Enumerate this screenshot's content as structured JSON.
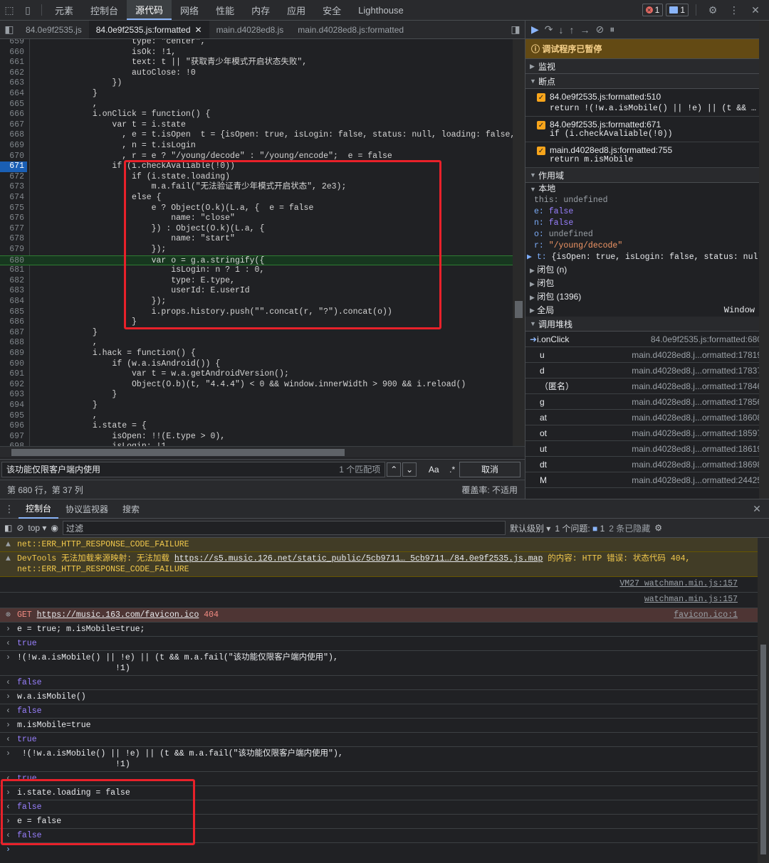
{
  "top_tabs": [
    "元素",
    "控制台",
    "源代码",
    "网络",
    "性能",
    "内存",
    "应用",
    "安全",
    "Lighthouse"
  ],
  "badges": {
    "errors": "1",
    "messages": "1"
  },
  "file_tabs": [
    "84.0e9f2535.js",
    "84.0e9f2535.js:formatted",
    "main.d4028ed8.js",
    "main.d4028ed8.js:formatted"
  ],
  "code_lines": [
    {
      "n": "659",
      "t": "                    type: \"center\","
    },
    {
      "n": "660",
      "t": "                    isOk: !1,"
    },
    {
      "n": "661",
      "t": "                    text: t || \"获取青少年模式开启状态失败\","
    },
    {
      "n": "662",
      "t": "                    autoClose: !0"
    },
    {
      "n": "663",
      "t": "                })"
    },
    {
      "n": "664",
      "t": "            }"
    },
    {
      "n": "665",
      "t": "            ,"
    },
    {
      "n": "666",
      "t": "            i.onClick = function() {"
    },
    {
      "n": "667",
      "t": "                var t = i.state"
    },
    {
      "n": "668",
      "t": "                  , e = t.isOpen  t = {isOpen: true, isLogin: false, status: null, loading: false,"
    },
    {
      "n": "669",
      "t": "                  , n = t.isLogin"
    },
    {
      "n": "670",
      "t": "                  , r = e ? \"/young/decode\" : \"/young/encode\";  e = false"
    },
    {
      "n": "671",
      "t": "                if (i.checkAvaliable(!0))"
    },
    {
      "n": "672",
      "t": "                    if (i.state.loading)"
    },
    {
      "n": "673",
      "t": "                        m.a.fail(\"无法验证青少年模式开启状态\", 2e3);"
    },
    {
      "n": "674",
      "t": "                    else {"
    },
    {
      "n": "675",
      "t": "                        e ? Object(O.k)(L.a, {  e = false"
    },
    {
      "n": "676",
      "t": "                            name: \"close\""
    },
    {
      "n": "677",
      "t": "                        }) : Object(O.k)(L.a, {"
    },
    {
      "n": "678",
      "t": "                            name: \"start\""
    },
    {
      "n": "679",
      "t": "                        });"
    },
    {
      "n": "680",
      "t": "                        var o = g.a.stringify({"
    },
    {
      "n": "681",
      "t": "                            isLogin: n ? 1 : 0,"
    },
    {
      "n": "682",
      "t": "                            type: E.type,"
    },
    {
      "n": "683",
      "t": "                            userId: E.userId"
    },
    {
      "n": "684",
      "t": "                        });"
    },
    {
      "n": "685",
      "t": "                        i.props.history.push(\"\".concat(r, \"?\").concat(o))"
    },
    {
      "n": "686",
      "t": "                    }"
    },
    {
      "n": "687",
      "t": "            }"
    },
    {
      "n": "688",
      "t": "            ,"
    },
    {
      "n": "689",
      "t": "            i.hack = function() {"
    },
    {
      "n": "690",
      "t": "                if (w.a.isAndroid()) {"
    },
    {
      "n": "691",
      "t": "                    var t = w.a.getAndroidVersion();"
    },
    {
      "n": "692",
      "t": "                    Object(O.b)(t, \"4.4.4\") < 0 && window.innerWidth > 900 && i.reload()"
    },
    {
      "n": "693",
      "t": "                }"
    },
    {
      "n": "694",
      "t": "            }"
    },
    {
      "n": "695",
      "t": "            ,"
    },
    {
      "n": "696",
      "t": "            i.state = {"
    },
    {
      "n": "697",
      "t": "                isOpen: !!(E.type > 0),"
    },
    {
      "n": "698",
      "t": "                isLogin: !1,"
    }
  ],
  "search": {
    "value": "该功能仅限客户端内使用",
    "matches": "1 个匹配项",
    "case": "Aa",
    "regex": ".*",
    "cancel": "取消"
  },
  "status": {
    "position": "第 680 行，第 37 列",
    "coverage": "覆盖率: 不适用"
  },
  "debugger": {
    "paused": "调试程序已暂停",
    "watch": "监视",
    "breakpoints_title": "断点",
    "breakpoints": [
      {
        "file": "84.0e9f2535.js:formatted:510",
        "code": "return !(!w.a.isMobile() || !e) || (t && m.a.fail(\"该功能仅限客户端内使用\"), !1)"
      },
      {
        "file": "84.0e9f2535.js:formatted:671",
        "code": "if (i.checkAvaliable(!0))"
      },
      {
        "file": "main.d4028ed8.js:formatted:755",
        "code": "return m.isMobile"
      }
    ],
    "scope_title": "作用域",
    "local": "本地",
    "scope_vars": [
      {
        "k": "this",
        "v": "undefined"
      },
      {
        "k": "e",
        "v": "false"
      },
      {
        "k": "n",
        "v": "false"
      },
      {
        "k": "o",
        "v": "undefined"
      },
      {
        "k": "r",
        "v": "\"/young/decode\""
      },
      {
        "k": "t",
        "v": "{isOpen: true, isLogin: false, status: null"
      }
    ],
    "closures": [
      "闭包 (n)",
      "闭包",
      "闭包 (1396)"
    ],
    "global": "全局",
    "global_val": "Window",
    "callstack_title": "调用堆栈",
    "callstack": [
      {
        "fn": "i.onClick",
        "loc": "84.0e9f2535.js:formatted:680"
      },
      {
        "fn": "u",
        "loc": "main.d4028ed8.j...ormatted:17819"
      },
      {
        "fn": "d",
        "loc": "main.d4028ed8.j...ormatted:17837"
      },
      {
        "fn": "（匿名）",
        "loc": "main.d4028ed8.j...ormatted:17846"
      },
      {
        "fn": "g",
        "loc": "main.d4028ed8.j...ormatted:17856"
      },
      {
        "fn": "at",
        "loc": "main.d4028ed8.j...ormatted:18608"
      },
      {
        "fn": "ot",
        "loc": "main.d4028ed8.j...ormatted:18597"
      },
      {
        "fn": "ut",
        "loc": "main.d4028ed8.j...ormatted:18619"
      },
      {
        "fn": "dt",
        "loc": "main.d4028ed8.j...ormatted:18698"
      },
      {
        "fn": "M",
        "loc": "main.d4028ed8.j...ormatted:24425"
      }
    ]
  },
  "drawer_tabs": [
    "控制台",
    "协议监视器",
    "搜索"
  ],
  "console_toolbar": {
    "context": "top",
    "filter": "过滤",
    "level": "默认级别",
    "issues": "1 个问题:",
    "issues_count": "1",
    "hidden": "2 条已隐藏"
  },
  "console_msgs": {
    "warn1": "net::ERR_HTTP_RESPONSE_CODE_FAILURE",
    "warn2a": "DevTools 无法加载来源映射: 无法加载 ",
    "warn2link": "https://s5.music.126.net/static_public/5cb9711… 5cb9711…/84.0e9f2535.js.map",
    "warn2b": " 的内容: HTTP 错误: 状态代码 404,",
    "warn2c": "net::ERR_HTTP_RESPONSE_CODE_FAILURE",
    "src1": "VM27 watchman.min.js:157",
    "src2": "watchman.min.js:157",
    "err_get": "GET ",
    "err_url": "https://music.163.com/favicon.ico",
    "err_code": " 404",
    "err_src": "favicon.ico:1",
    "entries": [
      {
        "type": "in",
        "text": "e = true; m.isMobile=true;"
      },
      {
        "type": "out",
        "text": "true"
      },
      {
        "type": "in",
        "text": "!(!w.a.isMobile() || !e) || (t && m.a.fail(\"该功能仅限客户端内使用\"),\n                    !1)"
      },
      {
        "type": "out",
        "text": "false"
      },
      {
        "type": "in",
        "text": "w.a.isMobile()"
      },
      {
        "type": "out",
        "text": "false"
      },
      {
        "type": "in",
        "text": "m.isMobile=true"
      },
      {
        "type": "out",
        "text": "true"
      },
      {
        "type": "in",
        "text": " !(!w.a.isMobile() || !e) || (t && m.a.fail(\"该功能仅限客户端内使用\"),\n                    !1)"
      },
      {
        "type": "out",
        "text": "true"
      },
      {
        "type": "in",
        "text": "i.state.loading = false"
      },
      {
        "type": "out",
        "text": "false"
      },
      {
        "type": "in",
        "text": "e = false"
      },
      {
        "type": "out",
        "text": "false"
      }
    ]
  }
}
